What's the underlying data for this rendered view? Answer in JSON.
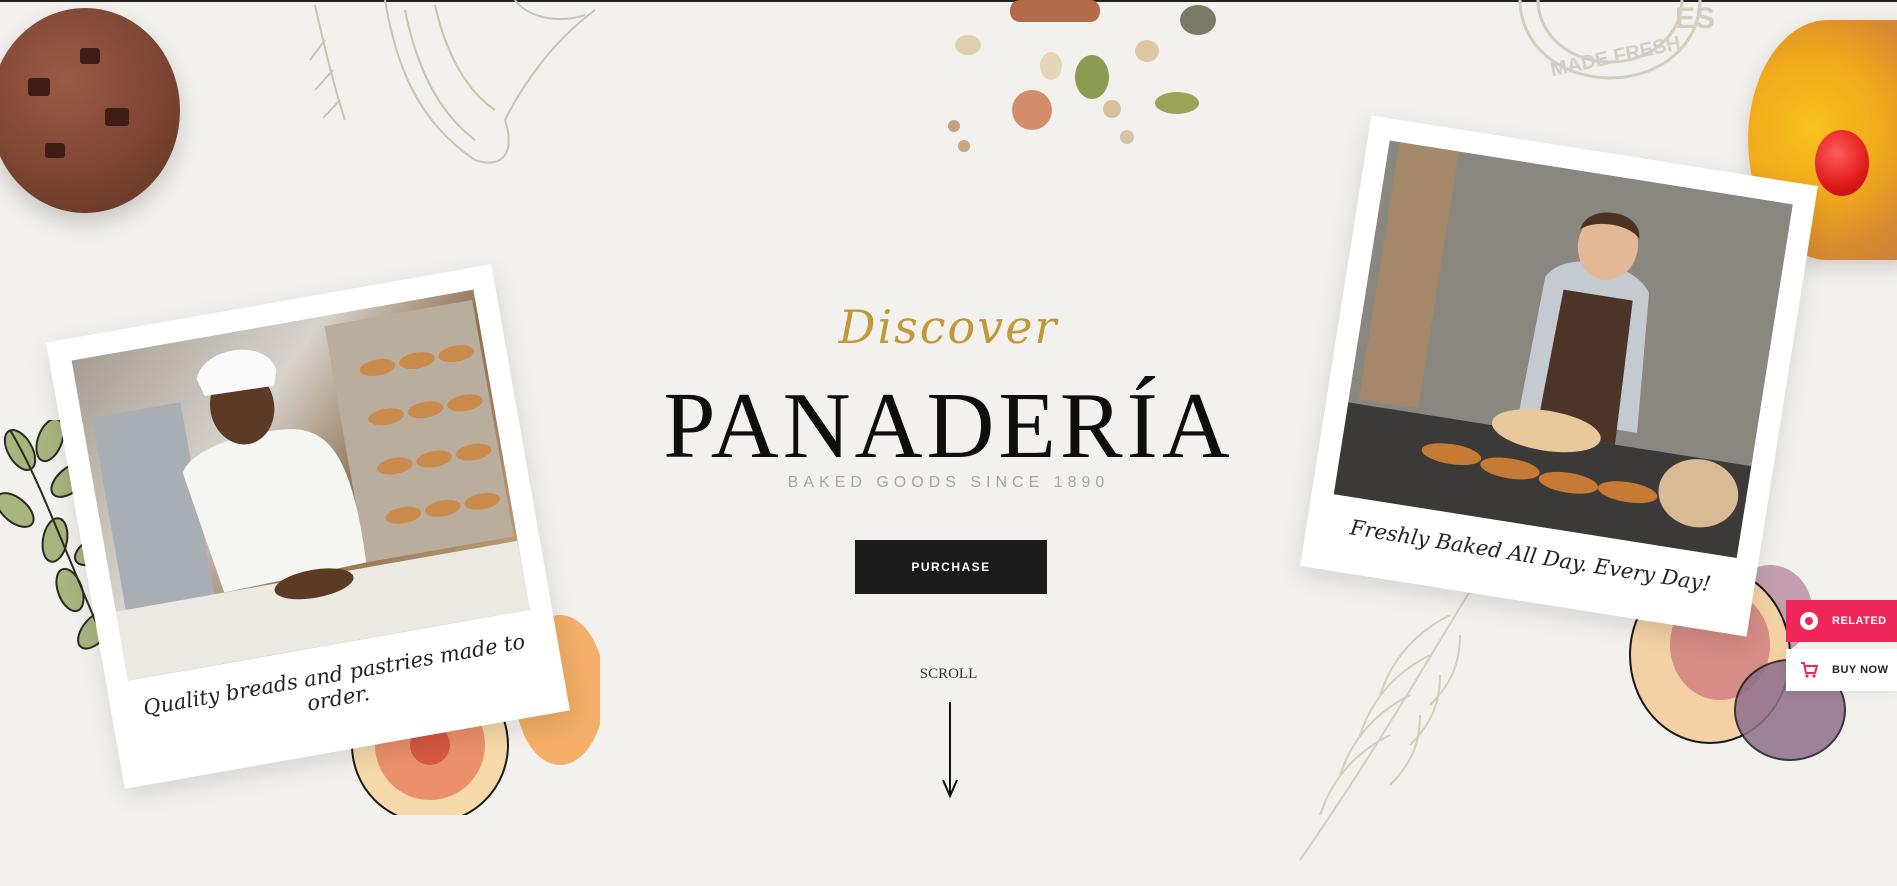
{
  "hero": {
    "script_word": "Discover",
    "title": "PANADERÍA",
    "subtitle": "BAKED GOODS SINCE 1890",
    "cta_label": "PURCHASE",
    "scroll_label": "SCROLL"
  },
  "polaroids": [
    {
      "caption": "Quality breads and pastries made to order."
    },
    {
      "caption": "Freshly Baked All Day. Every Day!"
    }
  ],
  "stamp_text": "MADE FRESH",
  "side_widgets": {
    "related_label": "RELATED",
    "buy_now_label": "BUY NOW"
  },
  "colors": {
    "background": "#f3f1ed",
    "accent_gold": "#c09a3a",
    "button_dark": "#1b1b1b",
    "related_pink": "#ee2758"
  }
}
